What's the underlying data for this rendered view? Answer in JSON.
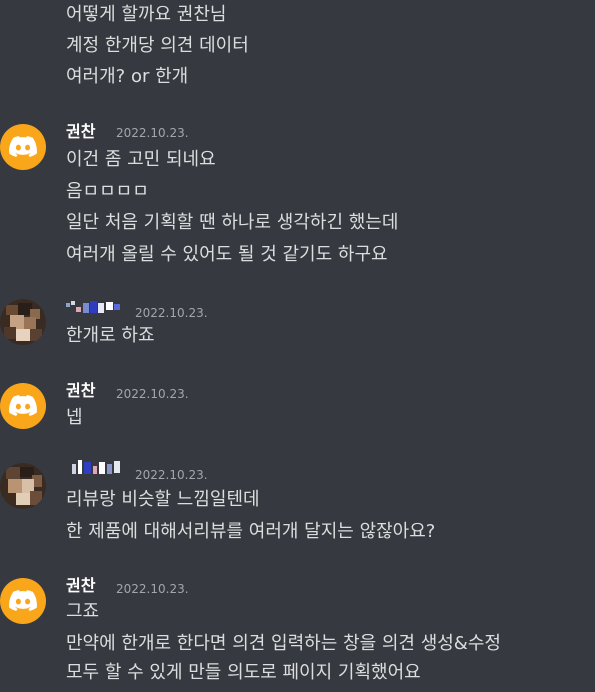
{
  "messages": [
    {
      "id": "cont-1",
      "lines": [
        "어떻게 할까요 권찬님",
        "계정 한개당 의견 데이터",
        "여러개? or 한개"
      ]
    },
    {
      "id": "group-1",
      "author": "권찬",
      "timestamp": "2022.10.23.",
      "avatar_icon": "discord-logo-icon",
      "lines": [
        "이건 좀 고민 되네요",
        "음ㅁㅁㅁㅁ",
        "일단 처음 기획할 땐 하나로 생각하긴 했는데",
        "여러개 올릴 수 있어도 될 것 같기도 하구요"
      ]
    },
    {
      "id": "group-2",
      "author": "",
      "timestamp": "2022.10.23.",
      "avatar_icon": "pixelated-avatar",
      "lines": [
        "한개로 하죠"
      ]
    },
    {
      "id": "group-3",
      "author": "권찬",
      "timestamp": "2022.10.23.",
      "avatar_icon": "discord-logo-icon",
      "lines": [
        "넵"
      ]
    },
    {
      "id": "group-4",
      "author": "",
      "timestamp": "2022.10.23.",
      "avatar_icon": "pixelated-avatar",
      "lines": [
        "리뷰랑 비슷할 느낌일텐데",
        "한 제품에 대해서리뷰를 여러개 달지는 않잖아요?"
      ]
    },
    {
      "id": "group-5",
      "author": "권찬",
      "timestamp": "2022.10.23.",
      "avatar_icon": "discord-logo-icon",
      "lines": [
        "그죠",
        "만약에 한개로 한다면 의견 입력하는 창을 의견 생성&수정",
        "모두 할 수 있게 만들 의도로 페이지 기획했어요"
      ]
    }
  ],
  "colors": {
    "background": "#36393f",
    "text": "#dcddde",
    "author": "#ffffff",
    "timestamp": "#a3a6aa",
    "discord_avatar": "#faa61a"
  }
}
